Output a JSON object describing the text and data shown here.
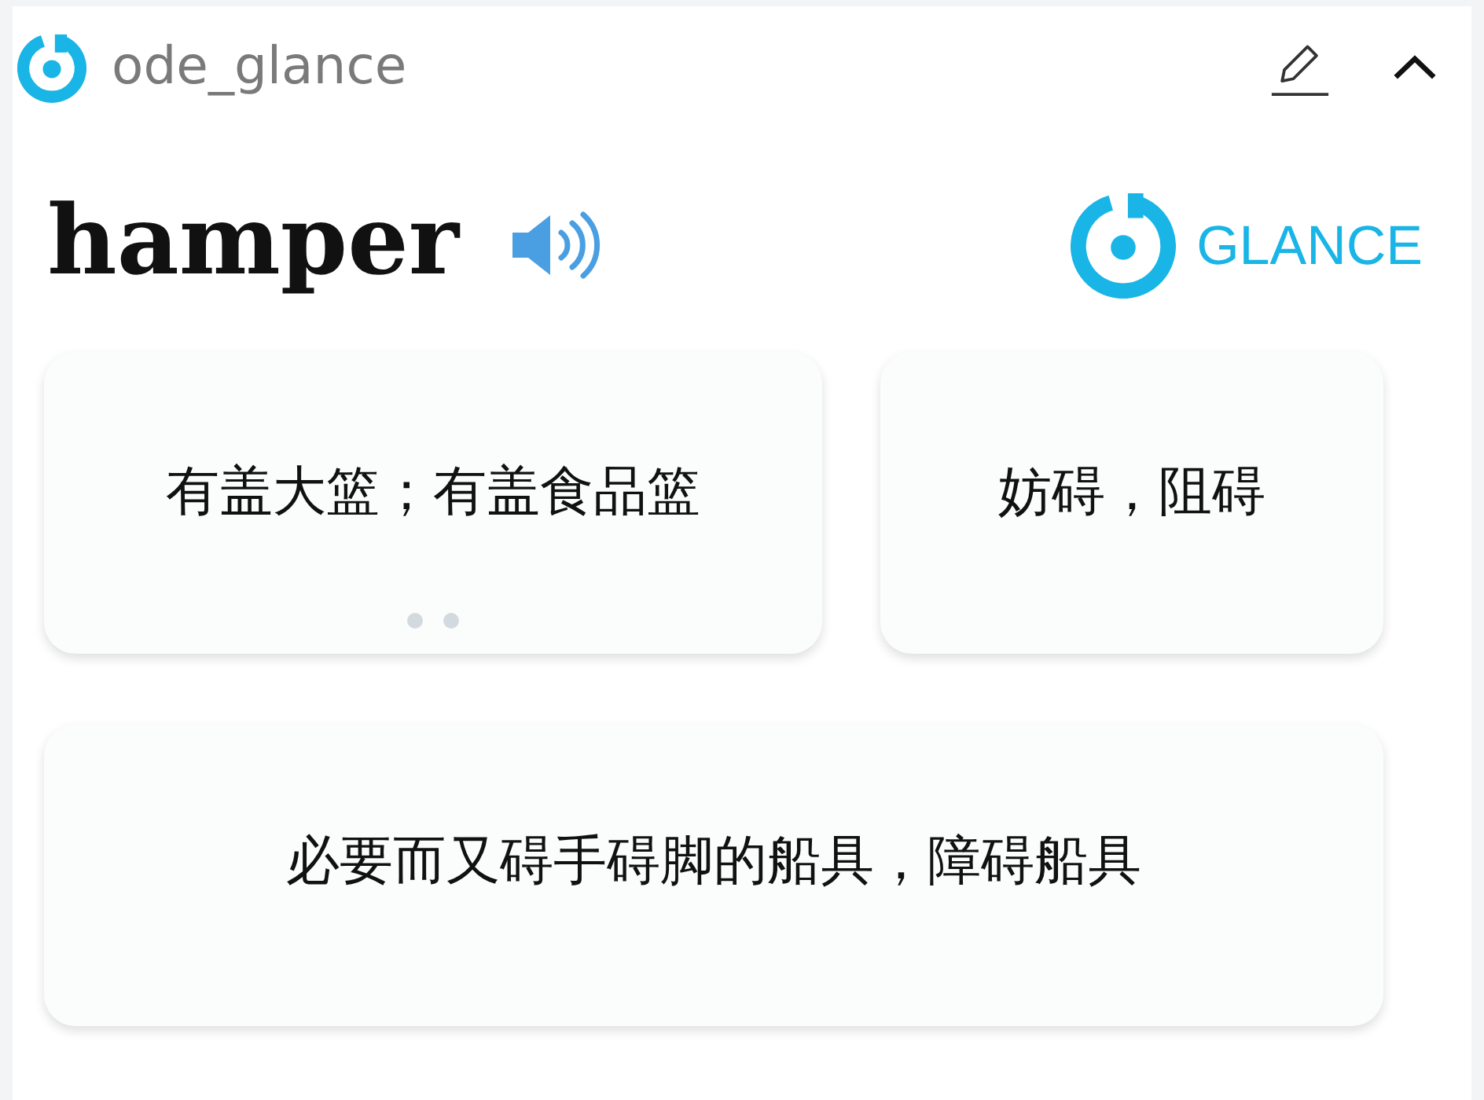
{
  "header": {
    "app_name": "ode_glance"
  },
  "entry": {
    "word": "hamper",
    "brand": "GLANCE"
  },
  "senses": [
    {
      "text": "有盖大篮；有盖食品篮",
      "pager": [
        {
          "selected": false
        },
        {
          "selected": false
        }
      ]
    },
    {
      "text": "妨碍，阻碍"
    },
    {
      "text": "必要而又碍手碍脚的船具，障碍船具"
    }
  ]
}
